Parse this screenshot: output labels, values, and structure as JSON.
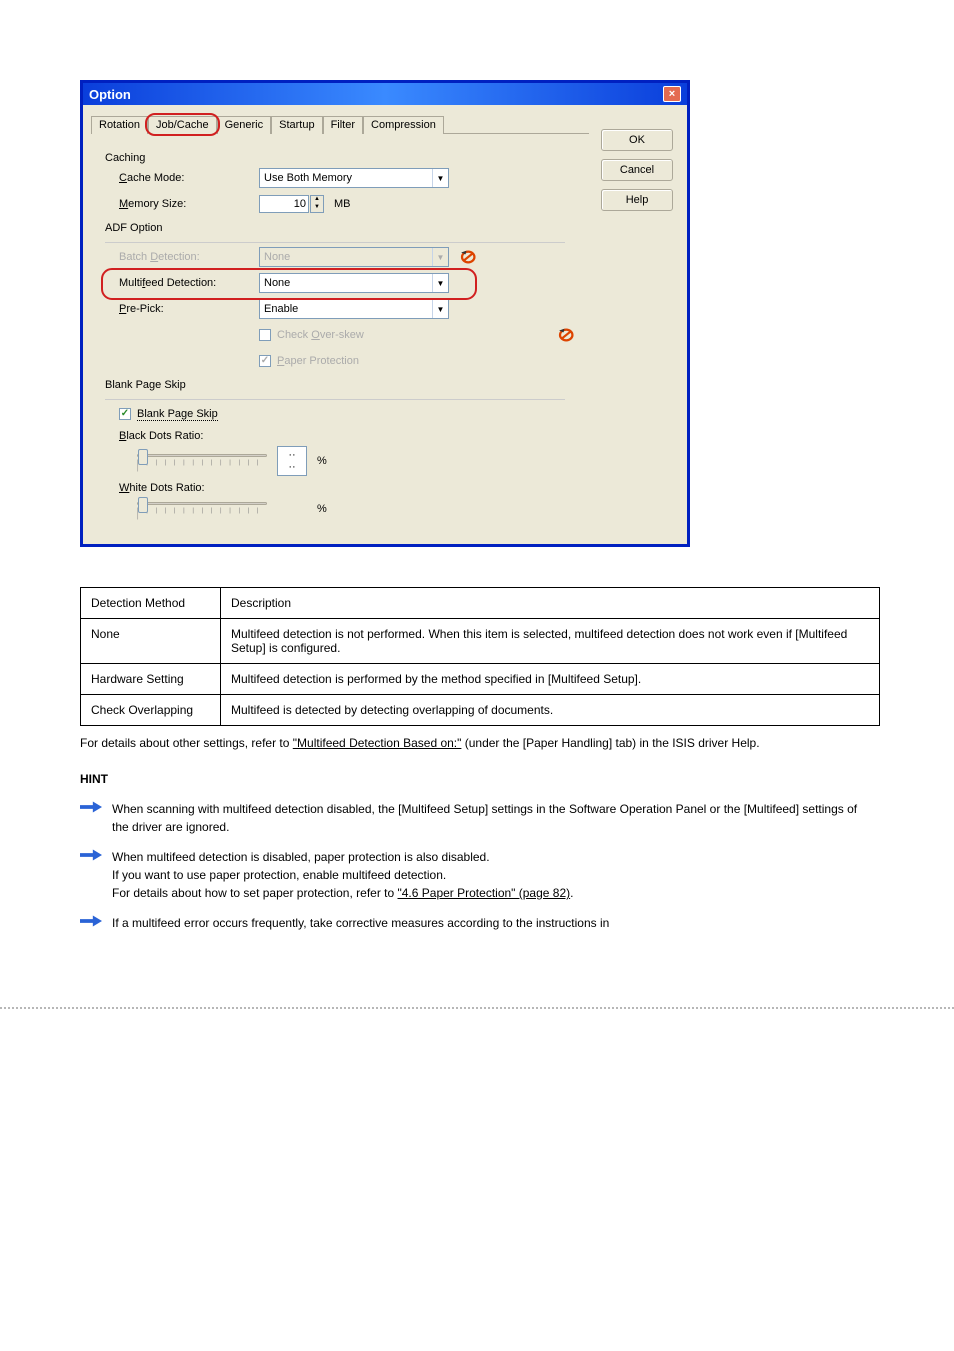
{
  "dialog": {
    "title": "Option",
    "tabs": [
      "Rotation",
      "Job/Cache",
      "Generic",
      "Startup",
      "Filter",
      "Compression"
    ],
    "active_tab_index": 1,
    "groups": {
      "caching": {
        "title": "Caching",
        "cache_mode_label": "Cache Mode:",
        "cache_mode_value": "Use Both Memory",
        "memory_size_label": "Memory Size:",
        "memory_size_value": "10",
        "memory_size_unit": "MB"
      },
      "adf": {
        "title": "ADF Option",
        "batch_label": "Batch Detection:",
        "batch_value": "None",
        "multifeed_label": "Multifeed Detection:",
        "multifeed_value": "None",
        "prepick_label": "Pre-Pick:",
        "prepick_value": "Enable",
        "overskew_label": " Check Over-skew",
        "paperprot_label": " Paper Protection"
      },
      "blank": {
        "title": "Blank Page Skip",
        "skip_label": "Blank Page Skip",
        "black_label": "Black Dots Ratio:",
        "white_label": "White Dots Ratio:",
        "pct": "%"
      }
    },
    "buttons": {
      "ok": "OK",
      "cancel": "Cancel",
      "help": "Help"
    }
  },
  "cond_table": {
    "rows": [
      {
        "label": "Detection Method",
        "desc": "Description"
      },
      {
        "label": "None",
        "desc": "Multifeed detection is not performed. When this item is selected, multifeed detection does not work even if [Multifeed Setup] is configured."
      },
      {
        "label": "Hardware Setting",
        "desc": "Multifeed detection is performed by the method specified in [Multifeed Setup]."
      },
      {
        "label": "Check Overlapping",
        "desc": "Multifeed is detected by detecting overlapping of documents."
      }
    ]
  },
  "body_text": {
    "line1_a": "For details about other settings, refer to ",
    "line1_ref": "\"Multifeed Detection Based on:\"",
    "line1_b": " (under the [Paper Handling] tab) in the ISIS driver Help.",
    "hint_label": "HINT",
    "hint1": "When scanning with multifeed detection disabled, the [Multifeed Setup] settings in the Software Operation Panel or the [Multifeed] settings of the driver are ignored.",
    "hint2_a": "When multifeed detection is disabled, paper protection is also disabled.",
    "hint2_b": "If you want to use paper protection, enable multifeed detection.",
    "hint2_c": "For details about how to set paper protection, refer to ",
    "hint2_ref": "\"4.6 Paper Protection\" (page 82)",
    "hint2_d": ".",
    "hint3": "If a multifeed error occurs frequently, take corrective measures according to the instructions in"
  }
}
